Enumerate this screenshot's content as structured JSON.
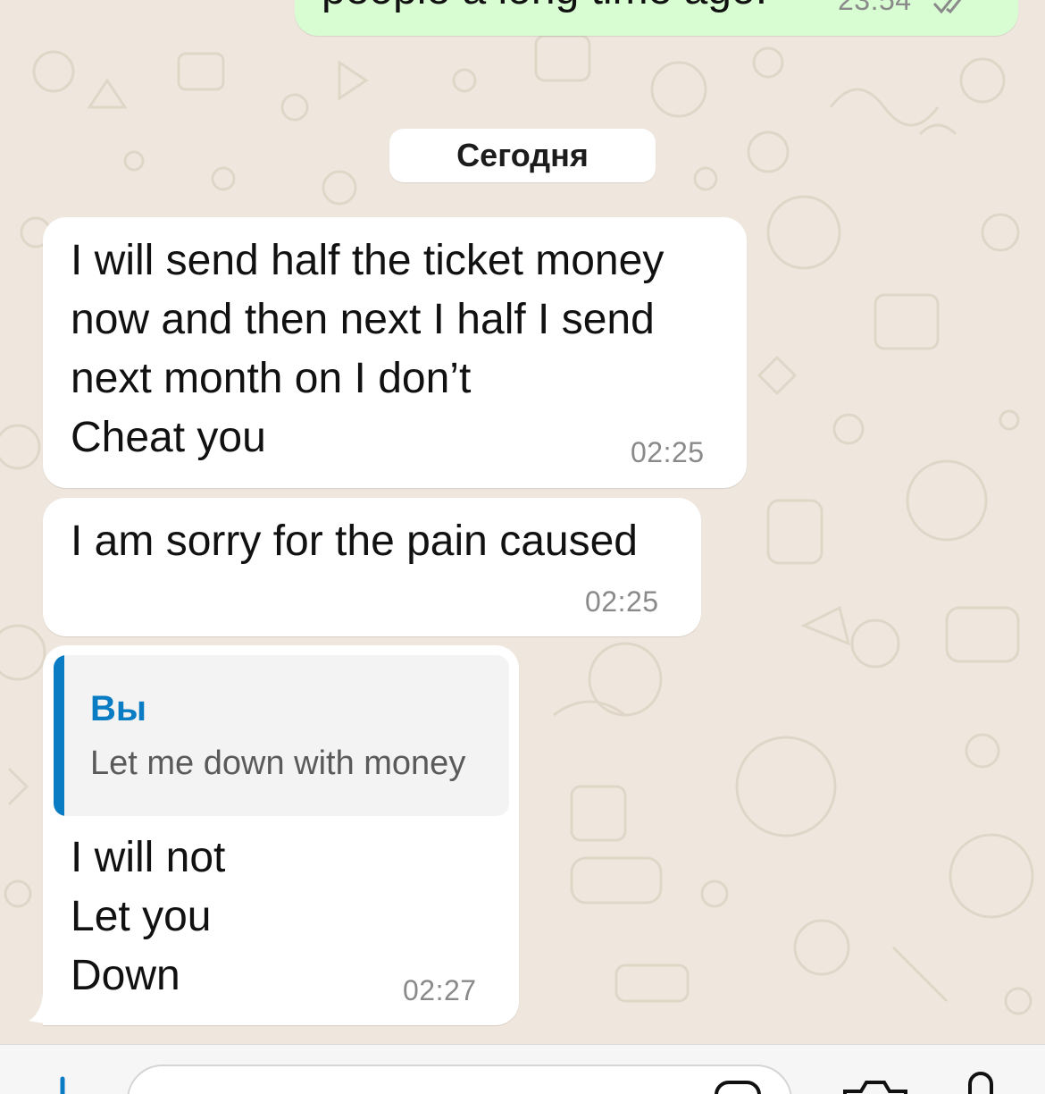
{
  "top_message": {
    "text_fragment": "people a long time ago.",
    "time": "23:54",
    "status_icon": "double-check-read-icon"
  },
  "date_divider": "Сегодня",
  "messages": [
    {
      "text": "I will send half the ticket money\nnow and then next I half I send\nnext month on I don’t\nCheat you",
      "time": "02:25"
    },
    {
      "text": "I am sorry for the pain caused",
      "time": "02:25"
    },
    {
      "reply": {
        "author": "Вы",
        "text": "Let me down with money"
      },
      "text": "I will not\nLet you\nDown",
      "time": "02:27"
    }
  ],
  "composer": {
    "left_icon": "plus-icon",
    "right_icons": [
      "sticker-icon",
      "camera-icon",
      "microphone-icon"
    ]
  },
  "colors": {
    "chat_background": "#efe7dd",
    "incoming_bubble": "#ffffff",
    "outgoing_bubble": "#d9fdd3",
    "reply_accent": "#0a7cc4",
    "time_text": "#8a8a8a"
  }
}
